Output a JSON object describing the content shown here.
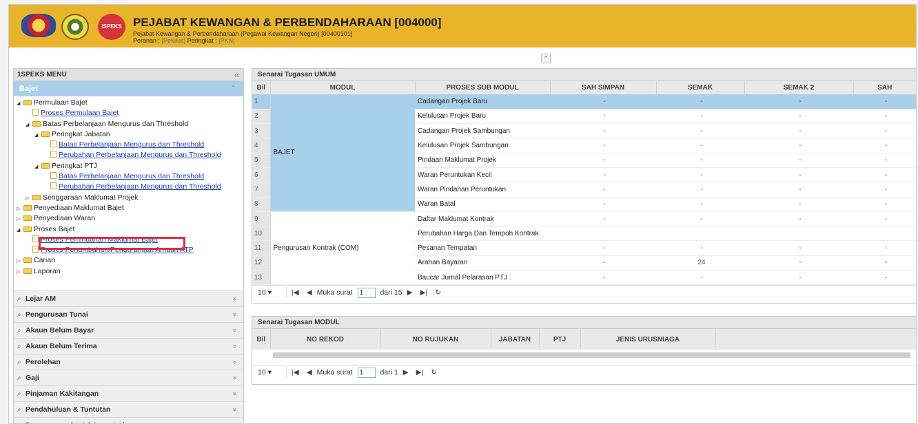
{
  "header": {
    "title": "PEJABAT KEWANGAN & PERBENDAHARAAN [004000]",
    "subtitle": "Pejabat Kewangan & Perbendaharaan (Pegawai Kewangan Negeri) [00400101]",
    "role_label": "Peranan :",
    "role_value": "[Pelulus]",
    "level_label": "Peringkat :",
    "level_value": "[PKN]",
    "logo_text": "iSPEKS"
  },
  "sidebar": {
    "title": "1SPEKS MENU",
    "active_section": "Bajet",
    "tree": [
      {
        "label": "Permulaan Bajet",
        "type": "folder",
        "depth": 0,
        "open": true
      },
      {
        "label": "Proses Permulaan Bajet",
        "type": "file",
        "depth": 1
      },
      {
        "label": "Batas Perbelanjaan Mengurus dan Threshold",
        "type": "folder",
        "depth": 1,
        "open": true
      },
      {
        "label": "Peringkat Jabatan",
        "type": "folder",
        "depth": 2,
        "open": true
      },
      {
        "label": "Batas Perbelanjaan Mengurus dan Threshold",
        "type": "file",
        "depth": 3
      },
      {
        "label": "Perubahan Perbelanjaan Mengurus dan Threshold",
        "type": "file",
        "depth": 3
      },
      {
        "label": "Peringkat PTJ",
        "type": "folder",
        "depth": 2,
        "open": true
      },
      {
        "label": "Batas Perbelanjaan Mengurus dan Threshold",
        "type": "file",
        "depth": 3
      },
      {
        "label": "Perubahan Perbelanjaan Mengurus dan Threshold",
        "type": "file",
        "depth": 3
      },
      {
        "label": "Senggaraan Maklumat Projek",
        "type": "folder",
        "depth": 1,
        "open": false
      },
      {
        "label": "Penyediaan Maklumat Bajet",
        "type": "folder",
        "depth": 0,
        "open": false
      },
      {
        "label": "Penyediaan Waran",
        "type": "folder",
        "depth": 0,
        "open": false
      },
      {
        "label": "Proses Bajet",
        "type": "folder",
        "depth": 0,
        "open": true
      },
      {
        "label": "Proses Pemindahan Maklumat Bajet",
        "type": "file",
        "depth": 1
      },
      {
        "label": "Proses Penambahan/Pengurangan Amaun ATP",
        "type": "file",
        "depth": 1
      },
      {
        "label": "Carian",
        "type": "folder",
        "depth": 0,
        "open": false
      },
      {
        "label": "Laporan",
        "type": "folder",
        "depth": 0,
        "open": false
      }
    ],
    "sections": [
      "Lejar AM",
      "Pengurusan Tunai",
      "Akaun Belum Bayar",
      "Akaun Belum Terima",
      "Perolehan",
      "Gaji",
      "Pinjaman Kakitangan",
      "Pendahuluan & Tuntutan",
      "Pengurusan Aset & Inventori"
    ]
  },
  "umum": {
    "title": "Senarai Tugasan UMUM",
    "columns": [
      "Bil",
      "MODUL",
      "PROSES SUB MODUL",
      "SAH SIMPAN",
      "SEMAK",
      "SEMAK 2",
      "SAH"
    ],
    "rows": [
      {
        "bil": "1",
        "proses": "Cadangan Projek Baru",
        "sah_simpan": "-",
        "semak": "-",
        "semak2": "-",
        "sah": "-"
      },
      {
        "bil": "2",
        "proses": "Kelulusan Projek Baru",
        "sah_simpan": "-",
        "semak": "-",
        "semak2": "-",
        "sah": "-"
      },
      {
        "bil": "3",
        "proses": "Cadangan Projek Sambungan",
        "sah_simpan": "-",
        "semak": "-",
        "semak2": "-",
        "sah": "-"
      },
      {
        "bil": "4",
        "proses": "Kelulusan Projek Sambungan",
        "sah_simpan": "-",
        "semak": "-",
        "semak2": "-",
        "sah": "-"
      },
      {
        "bil": "5",
        "proses": "Pindaan Maklumat Projek",
        "sah_simpan": "-",
        "semak": "-",
        "semak2": "-",
        "sah": "-"
      },
      {
        "bil": "6",
        "proses": "Waran Peruntukan Kecil",
        "sah_simpan": "-",
        "semak": "-",
        "semak2": "-",
        "sah": "-"
      },
      {
        "bil": "7",
        "proses": "Waran Pindahan Peruntukan",
        "sah_simpan": "-",
        "semak": "-",
        "semak2": "-",
        "sah": "-"
      },
      {
        "bil": "8",
        "proses": "Waran Batal",
        "sah_simpan": "-",
        "semak": "-",
        "semak2": "-",
        "sah": "-"
      },
      {
        "bil": "9",
        "proses": "Daftar Maklumat Kontrak",
        "sah_simpan": "-",
        "semak": "-",
        "semak2": "-",
        "sah": "-"
      },
      {
        "bil": "10",
        "proses": "Perubahan Harga Dan Tempoh Kontrak",
        "sah_simpan": "",
        "semak": "",
        "semak2": "",
        "sah": ""
      },
      {
        "bil": "11",
        "proses": "Pesanan Tempatan",
        "sah_simpan": "-",
        "semak": "-",
        "semak2": "-",
        "sah": "-"
      },
      {
        "bil": "12",
        "proses": "Arahan Bayaran",
        "sah_simpan": "-",
        "semak": "24",
        "semak2": "-",
        "sah": "-"
      },
      {
        "bil": "13",
        "proses": "Baucar Jurnal Pelarasan PTJ",
        "sah_simpan": "-",
        "semak": "-",
        "semak2": "-",
        "sah": "-"
      }
    ],
    "modul_bajet": "BAJET",
    "modul_kontrak": "Pengurusan Kontrak (COM)",
    "pager": {
      "page_size": "10",
      "page_label": "Muka surat",
      "page": "1",
      "of_label": "dari 15"
    }
  },
  "modul": {
    "title": "Senarai Tugasan MODUL",
    "columns": [
      "Bil",
      "NO REKOD",
      "NO RUJUKAN",
      "JABATAN",
      "PTJ",
      "JENIS URUSNIAGA"
    ],
    "pager": {
      "page_size": "10",
      "page_label": "Muka surat",
      "page": "1",
      "of_label": "dari 1"
    }
  }
}
